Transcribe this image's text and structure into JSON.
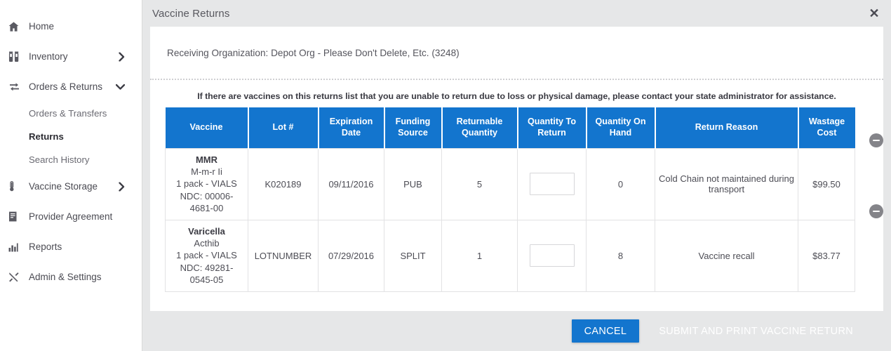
{
  "sidebar": {
    "items": [
      {
        "label": "Home",
        "icon": "home-icon",
        "chevron": null,
        "active": false
      },
      {
        "label": "Inventory",
        "icon": "vials-icon",
        "chevron": "chevron-right-icon",
        "active": false
      },
      {
        "label": "Orders & Returns",
        "icon": "exchange-arrows-icon",
        "chevron": "chevron-down-icon",
        "active": false
      }
    ],
    "sub_items": [
      {
        "label": "Orders & Transfers",
        "active": false
      },
      {
        "label": "Returns",
        "active": true
      },
      {
        "label": "Search History",
        "active": false
      }
    ],
    "items_after": [
      {
        "label": "Vaccine Storage",
        "icon": "thermometer-icon",
        "chevron": "chevron-right-icon",
        "active": false
      },
      {
        "label": "Provider Agreement",
        "icon": "document-icon",
        "chevron": null,
        "active": false
      },
      {
        "label": "Reports",
        "icon": "bar-chart-icon",
        "chevron": null,
        "active": false
      },
      {
        "label": "Admin & Settings",
        "icon": "tools-icon",
        "chevron": null,
        "active": false
      }
    ]
  },
  "modal": {
    "title": "Vaccine Returns",
    "close_label": "✕",
    "organization_line": "Receiving Organization: Depot Org - Please Don't Delete, Etc. (3248)",
    "warning": "If there are vaccines on this returns list that you are unable to return due to loss or physical damage, please contact your state administrator for assistance.",
    "footer": {
      "cancel_label": "CANCEL",
      "submit_label": "SUBMIT AND PRINT VACCINE RETURN"
    }
  },
  "table": {
    "columns": [
      "Vaccine",
      "Lot #",
      "Expiration Date",
      "Funding Source",
      "Returnable Quantity",
      "Quantity To Return",
      "Quantity On Hand",
      "Return Reason",
      "Wastage Cost"
    ],
    "rows": [
      {
        "vaccine_name": "MMR",
        "vaccine_brand": "M-m-r Ii",
        "vaccine_pack": "1 pack - VIALS",
        "vaccine_ndc": "NDC: 00006-4681-00",
        "lot": "K020189",
        "expiration_date": "09/11/2016",
        "funding_source": "PUB",
        "returnable_quantity": "5",
        "quantity_to_return": "",
        "quantity_to_return_placeholder": "",
        "quantity_on_hand": "0",
        "return_reason": "Cold Chain not maintained during transport",
        "wastage_cost": "$99.50",
        "remove_icon": "minus-circle-icon"
      },
      {
        "vaccine_name": "Varicella",
        "vaccine_brand": "Acthib",
        "vaccine_pack": "1 pack - VIALS",
        "vaccine_ndc": "NDC: 49281-0545-05",
        "lot": "LOTNUMBER",
        "expiration_date": "07/29/2016",
        "funding_source": "SPLIT",
        "returnable_quantity": "1",
        "quantity_to_return": "",
        "quantity_to_return_placeholder": "",
        "quantity_on_hand": "8",
        "return_reason": "Vaccine recall",
        "wastage_cost": "$83.77",
        "remove_icon": "minus-circle-icon"
      }
    ]
  },
  "colors": {
    "accent_blue": "#1375ce",
    "modal_bg": "#e6e7e8",
    "panel_bg": "#ffffff",
    "remove_gray": "#848489"
  }
}
